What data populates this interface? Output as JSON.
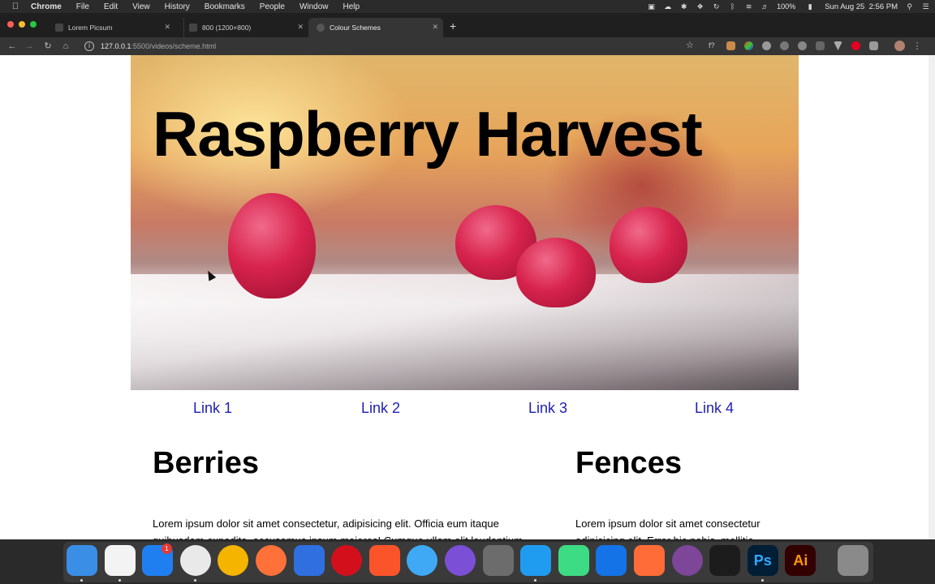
{
  "menubar": {
    "app_name": "Chrome",
    "menus": [
      "File",
      "Edit",
      "View",
      "History",
      "Bookmarks",
      "People",
      "Window",
      "Help"
    ],
    "battery": "100%",
    "datetime": "Sun Aug 25  2:56 PM"
  },
  "tabs": [
    {
      "title": "Lorem Picsum"
    },
    {
      "title": "800 (1200×800)"
    },
    {
      "title": "Colour Schemes",
      "active": true
    }
  ],
  "toolbar": {
    "url_host": "127.0.0.1",
    "url_path": ":5500/videos/scheme.html"
  },
  "page": {
    "hero_title": "Raspberry Harvest",
    "links": [
      "Link 1",
      "Link 2",
      "Link 3",
      "Link 4"
    ],
    "sections": [
      {
        "title": "Berries",
        "text": "Lorem ipsum dolor sit amet consectetur, adipisicing elit. Officia eum itaque quibusdam expedita, accusamus ipsum maiores! Cumque ullam elit laudantium"
      },
      {
        "title": "Fences",
        "text": "Lorem ipsum dolor sit amet consectetur adipisicing elit. Error hic nobis, mollitia"
      }
    ]
  },
  "colors": {
    "link": "#1e1eb4",
    "menubar_bg": "#2b2b2b",
    "toolbar_bg": "#353535"
  },
  "dock": {
    "apps": [
      "finder-icon",
      "notes-icon",
      "app-store-icon",
      "chrome-icon",
      "chrome-canary-icon",
      "firefox-icon",
      "firefox-developer-icon",
      "opera-icon",
      "brave-icon",
      "safari-icon",
      "safari-technology-preview-icon",
      "claquette-icon",
      "vscode-icon",
      "android-studio-icon",
      "xcode-icon",
      "postman-icon",
      "tor-icon",
      "terminal-icon",
      "photoshop-icon",
      "illustrator-icon",
      "trash-icon"
    ],
    "app_store_badge": "1",
    "photoshop_label": "Ps",
    "illustrator_label": "Ai"
  }
}
